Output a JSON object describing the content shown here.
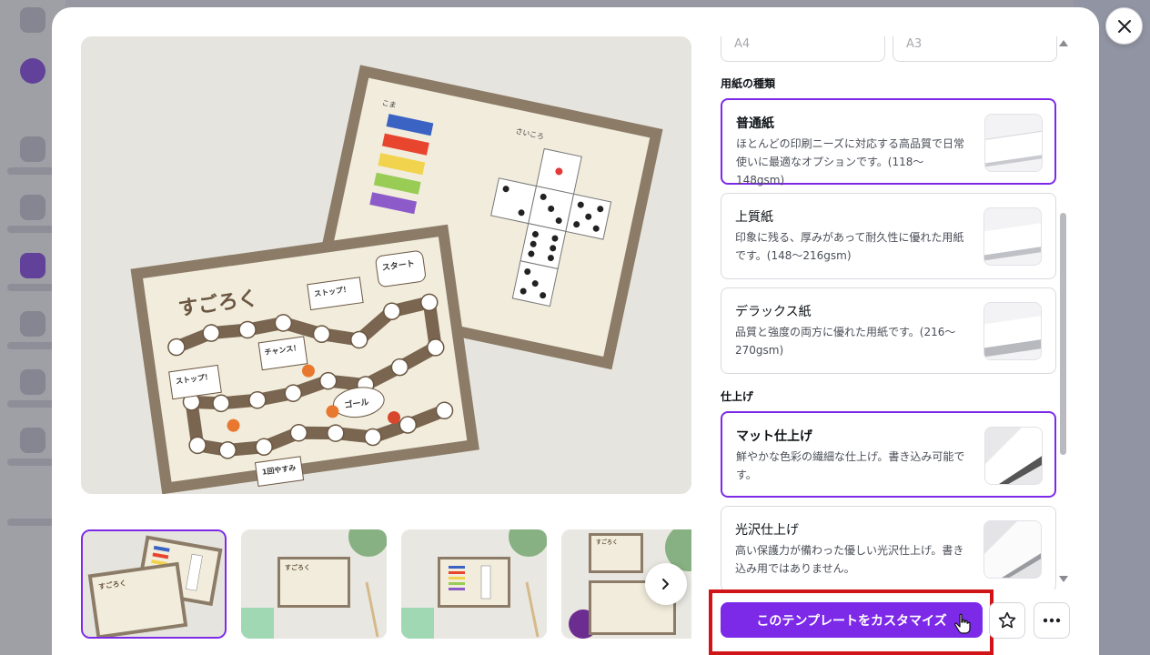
{
  "prev_fields": {
    "left_value": "A4",
    "right_value": "A3"
  },
  "sections": {
    "paper_type": {
      "title": "用紙の種類",
      "options": [
        {
          "title": "普通紙",
          "description": "ほとんどの印刷ニーズに対応する高品質で日常使いに最適なオプションです。(118〜148gsm)",
          "selected": true
        },
        {
          "title": "上質紙",
          "description": "印象に残る、厚みがあって耐久性に優れた用紙です。(148〜216gsm)",
          "selected": false
        },
        {
          "title": "デラックス紙",
          "description": "品質と強度の両方に優れた用紙です。(216〜270gsm)",
          "selected": false
        }
      ]
    },
    "finish": {
      "title": "仕上げ",
      "options": [
        {
          "title": "マット仕上げ",
          "description": "鮮やかな色彩の繊細な仕上げ。書き込み可能です。",
          "selected": true
        },
        {
          "title": "光沢仕上げ",
          "description": "高い保護力が備わった優しい光沢仕上げ。書き込み用ではありません。",
          "selected": false
        }
      ]
    }
  },
  "preview": {
    "board_title": "すごろく",
    "start_label": "スタート",
    "goal_label": "ゴール",
    "chance_label": "チャンス！",
    "stop_label": "ストップ！",
    "rest_label": "1回やすみ",
    "koma_label": "こま",
    "dice_label": "さいころ"
  },
  "thumbnails": [
    {
      "label": "すごろく",
      "selected": true
    },
    {
      "label": "すごろく",
      "selected": false
    },
    {
      "label": "",
      "selected": false
    },
    {
      "label": "すごろく",
      "selected": false
    }
  ],
  "actions": {
    "customize_label": "このテンプレートをカスタマイズ"
  },
  "colors": {
    "accent": "#7d2ae8",
    "highlight": "#d01418",
    "board_brown": "#8b7b67",
    "cream": "#f1ecdc"
  },
  "icons": {
    "close": "close-icon",
    "next": "chevron-right-icon",
    "star": "star-icon",
    "more": "more-icon"
  }
}
